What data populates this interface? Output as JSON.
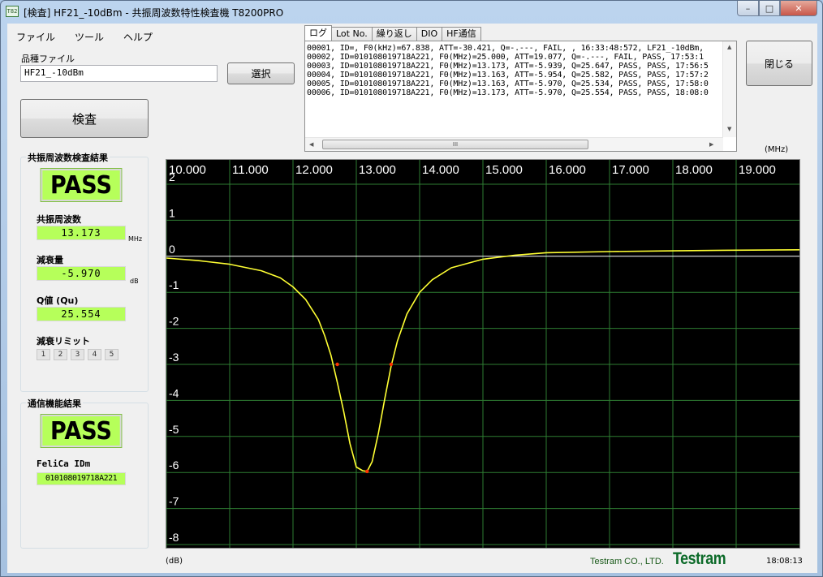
{
  "window": {
    "icon_text": "T82",
    "title": "[検査] HF21_-10dBm - 共振周波数特性検査機 T8200PRO"
  },
  "menu": [
    "ファイル",
    "ツール",
    "ヘルプ"
  ],
  "product_file": {
    "label": "品種ファイル",
    "value": "HF21_-10dBm",
    "select_label": "選択"
  },
  "inspect_button": "検査",
  "close_button": "閉じる",
  "resonance": {
    "group_title": "共振周波数検査結果",
    "result": "PASS",
    "freq_label": "共振周波数",
    "freq_value": "13.173",
    "freq_unit": "MHz",
    "atten_label": "減衰量",
    "atten_value": "-5.970",
    "atten_unit": "dB",
    "q_label": "Q値 (Qu)",
    "q_value": "25.554",
    "limit_label": "減衰リミット",
    "limits": [
      "1",
      "2",
      "3",
      "4",
      "5"
    ]
  },
  "comm": {
    "group_title": "通信機能結果",
    "result": "PASS",
    "idm_label": "FeliCa IDm",
    "idm_value": "010108019718A221"
  },
  "tabs": [
    "ログ",
    "Lot No.",
    "繰り返し",
    "DIO",
    "HF通信"
  ],
  "log_lines": [
    "00001, ID=, F0(kHz)=67.838, ATT=-30.421, Q=-.---, FAIL, , 16:33:48:572, LF21_-10dBm,",
    "00002, ID=010108019718A221, F0(MHz)=25.000, ATT=19.077, Q=-.---, FAIL, PASS, 17:53:1",
    "00003, ID=010108019718A221, F0(MHz)=13.173, ATT=-5.939, Q=25.647, PASS, PASS, 17:56:5",
    "00004, ID=010108019718A221, F0(MHz)=13.163, ATT=-5.954, Q=25.582, PASS, PASS, 17:57:2",
    "00005, ID=010108019718A221, F0(MHz)=13.163, ATT=-5.970, Q=25.534, PASS, PASS, 17:58:0",
    "00006, ID=010108019718A221, F0(MHz)=13.173, ATT=-5.970, Q=25.554, PASS, PASS, 18:08:0"
  ],
  "scroll_grip": "III",
  "chart_data": {
    "type": "line",
    "x_unit": "(MHz)",
    "y_unit": "(dB)",
    "xlim": [
      10.0,
      20.0
    ],
    "ylim": [
      -8,
      2
    ],
    "x_ticks": [
      "10.000",
      "11.000",
      "12.000",
      "13.000",
      "14.000",
      "15.000",
      "16.000",
      "17.000",
      "18.000",
      "19.000"
    ],
    "y_ticks": [
      "2",
      "1",
      "0",
      "-1",
      "-2",
      "-3",
      "-4",
      "-5",
      "-6",
      "-7",
      "-8"
    ],
    "series": [
      {
        "color": "#ffff33",
        "x": [
          10.0,
          10.5,
          11.0,
          11.5,
          11.8,
          12.0,
          12.2,
          12.4,
          12.5,
          12.6,
          12.7,
          12.8,
          12.9,
          13.0,
          13.1,
          13.17,
          13.25,
          13.35,
          13.45,
          13.55,
          13.65,
          13.8,
          14.0,
          14.2,
          14.5,
          15.0,
          15.5,
          16.0,
          17.0,
          18.0,
          19.0,
          20.0
        ],
        "y": [
          -0.05,
          -0.12,
          -0.22,
          -0.4,
          -0.6,
          -0.85,
          -1.2,
          -1.75,
          -2.2,
          -2.75,
          -3.5,
          -4.3,
          -5.2,
          -5.85,
          -5.95,
          -5.97,
          -5.7,
          -4.9,
          -3.95,
          -3.05,
          -2.35,
          -1.6,
          -1.0,
          -0.65,
          -0.32,
          -0.08,
          0.03,
          0.1,
          0.13,
          0.15,
          0.17,
          0.18
        ]
      }
    ],
    "markers": [
      {
        "x": 12.7,
        "y": -3.0,
        "color": "#ff3300"
      },
      {
        "x": 13.17,
        "y": -5.97,
        "color": "#ff3300"
      },
      {
        "x": 13.55,
        "y": -3.0,
        "color": "#ff3300"
      }
    ],
    "grid": true,
    "grid_color": "#2e7d32",
    "zero_line_color": "#ffffff"
  },
  "footer": {
    "company": "Testram CO., LTD.",
    "logo": "Testram",
    "time": "18:08:13"
  }
}
